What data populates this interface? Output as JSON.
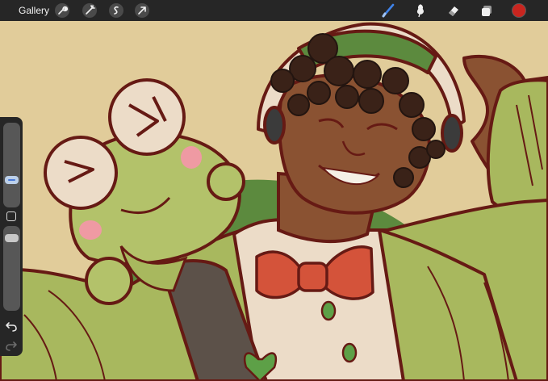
{
  "topbar": {
    "gallery_label": "Gallery",
    "actions": [
      "wrench-icon",
      "magic-wand-icon",
      "selection-icon",
      "transform-arrow-icon"
    ],
    "tools": [
      "brush-icon",
      "smudge-icon",
      "eraser-icon",
      "layers-icon"
    ],
    "active_tool": "brush-icon",
    "current_color": "#c8251f"
  },
  "sidebar": {
    "controls": [
      "brush-size-slider",
      "modify-button",
      "opacity-slider",
      "undo-icon",
      "redo-icon"
    ]
  },
  "colors": {
    "outline": "#661a14",
    "background": "#e1cc9a",
    "jacket_green": "#a8b85e",
    "frog_green": "#b3c26a",
    "skin": "#8a5232",
    "bowtie": "#d4533a",
    "sash": "#5c5149"
  }
}
